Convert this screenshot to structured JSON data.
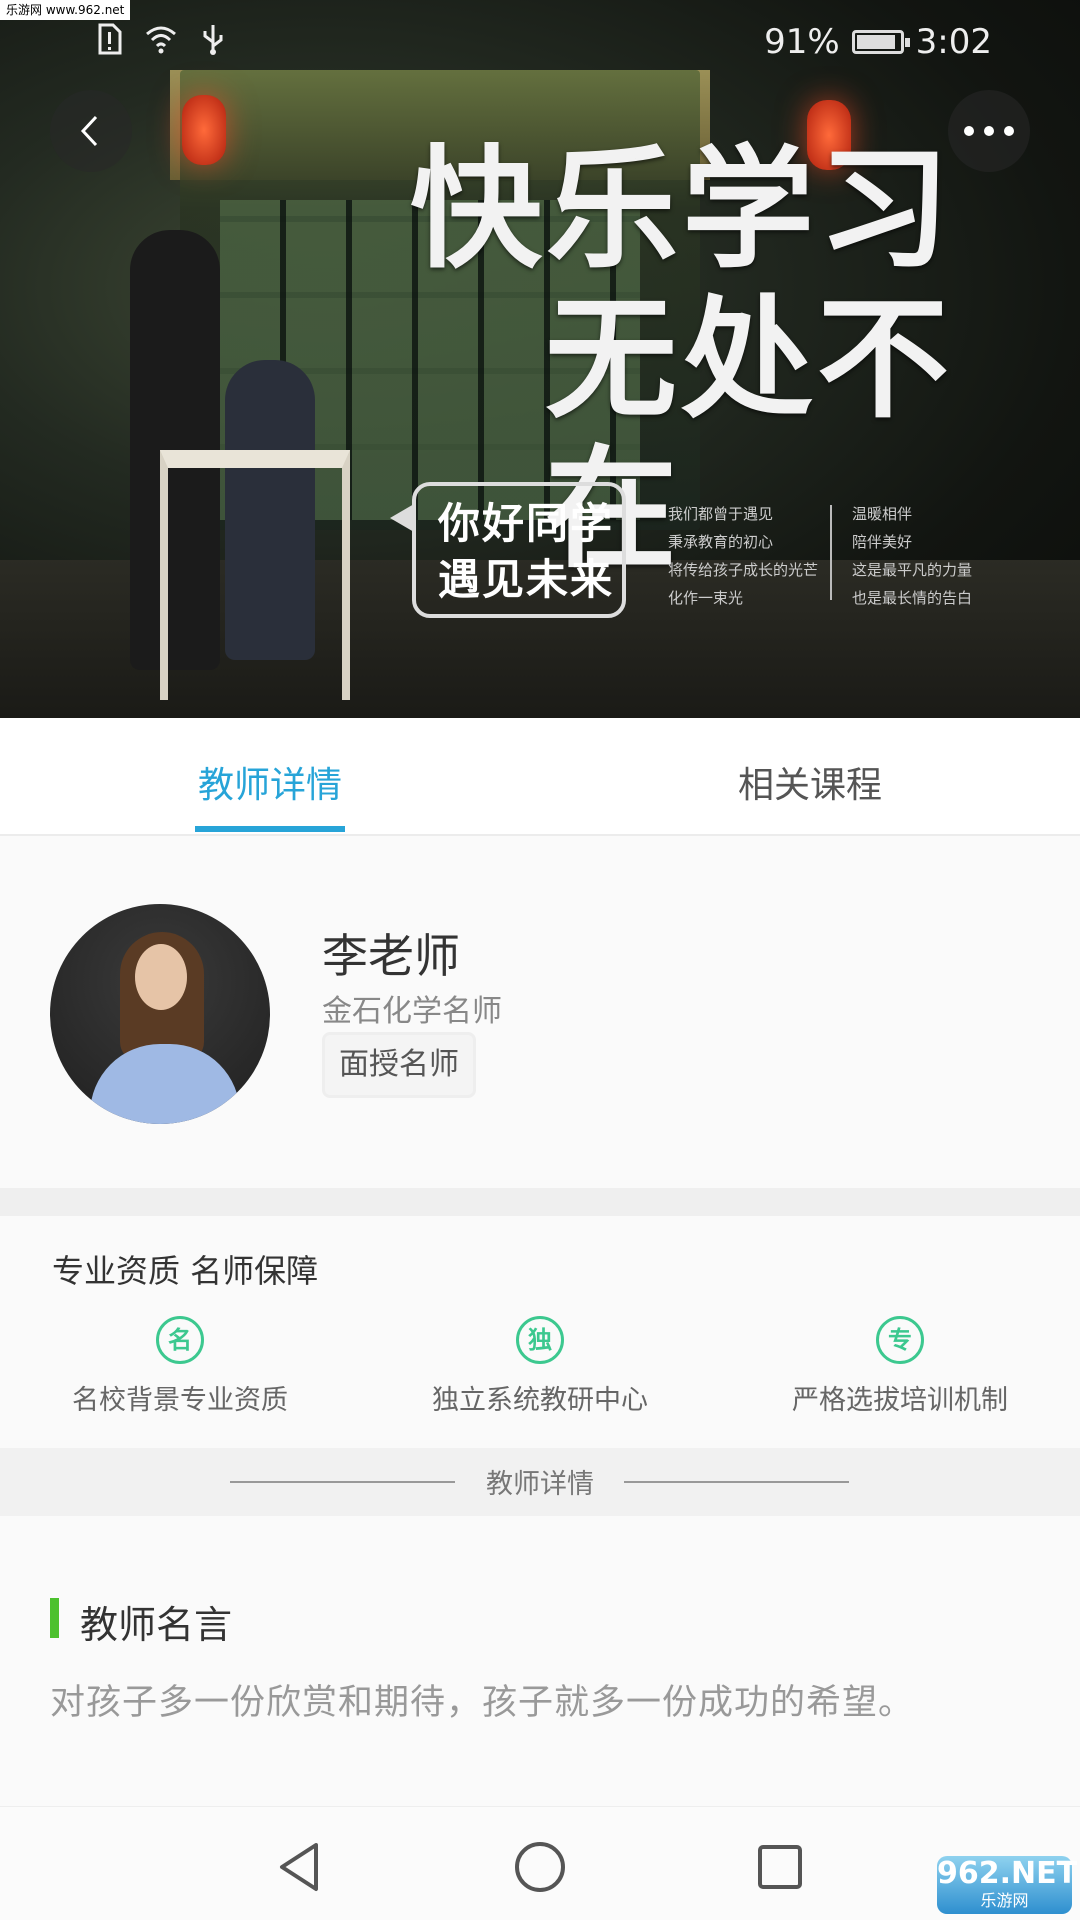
{
  "watermarks": {
    "top": "乐游网 www.962.net",
    "bottom_main": "962.NET",
    "bottom_sub": "乐游网"
  },
  "status_bar": {
    "battery_percent": "91%",
    "battery_level": 0.91,
    "time": "3:02"
  },
  "hero": {
    "title_line1": "快乐学习",
    "title_line2": "无处不在",
    "bubble_line1": "你好同学",
    "bubble_line2": "遇见未来",
    "small_col1": "我们都曾于遇见\n秉承教育的初心\n将传给孩子成长的光芒\n化作一束光",
    "small_col2": "温暖相伴\n陪伴美好\n这是最平凡的力量\n也是最长情的告白"
  },
  "tabs": [
    {
      "label": "教师详情",
      "active": true
    },
    {
      "label": "相关课程",
      "active": false
    }
  ],
  "teacher": {
    "name": "李老师",
    "title": "金石化学名师",
    "badge": "面授名师"
  },
  "qualifications": {
    "heading": "专业资质 名师保障",
    "items": [
      {
        "badge": "名",
        "label": "名校背景专业资质"
      },
      {
        "badge": "独",
        "label": "独立系统教研中心"
      },
      {
        "badge": "专",
        "label": "严格选拔培训机制"
      }
    ]
  },
  "section_separator": "教师详情",
  "motto": {
    "title": "教师名言",
    "text": "对孩子多一份欣赏和期待，孩子就多一份成功的希望。"
  },
  "colors": {
    "accent": "#27a4d8",
    "qual_green": "#3cc88f",
    "motto_bar": "#4cc12e"
  },
  "icons": [
    "back-arrow-icon",
    "more-dots-icon",
    "nav-back-icon",
    "nav-home-icon",
    "nav-recents-icon"
  ]
}
